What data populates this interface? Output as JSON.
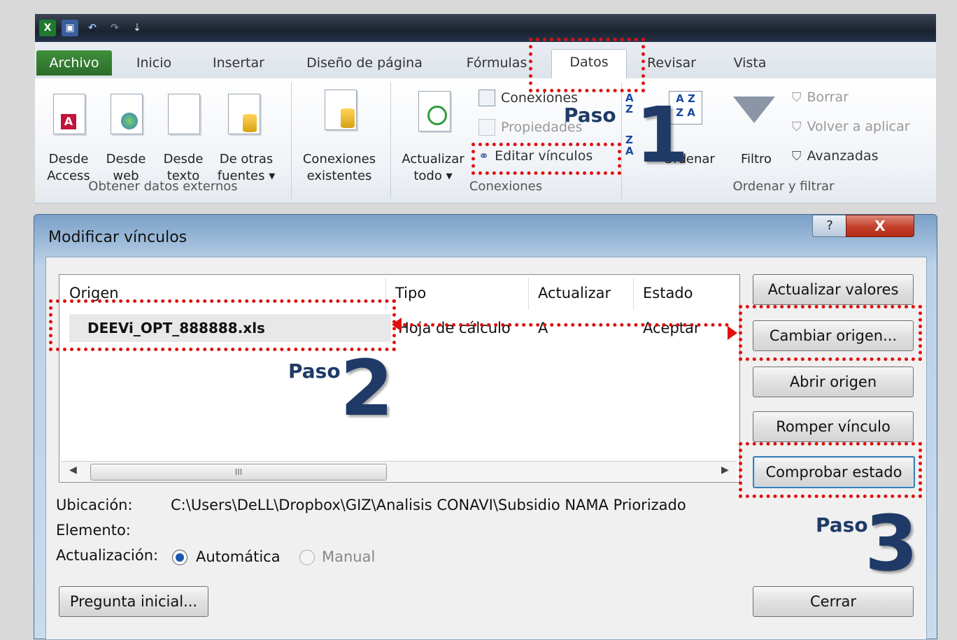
{
  "excel": {
    "tabs": [
      "Archivo",
      "Inicio",
      "Insertar",
      "Diseño de página",
      "Fórmulas",
      "Datos",
      "Revisar",
      "Vista"
    ],
    "obtener": {
      "buttons": [
        {
          "line1": "Desde",
          "line2": "Access"
        },
        {
          "line1": "Desde",
          "line2": "web"
        },
        {
          "line1": "Desde",
          "line2": "texto"
        },
        {
          "line1": "De otras",
          "line2": "fuentes ▾"
        }
      ],
      "group_label": "Obtener datos externos"
    },
    "conexiones_existentes": {
      "line1": "Conexiones",
      "line2": "existentes"
    },
    "conexiones_group": {
      "actualizar": {
        "line1": "Actualizar",
        "line2": "todo ▾"
      },
      "items": [
        "Conexiones",
        "Propiedades",
        "Editar vínculos"
      ],
      "group_label": "Conexiones"
    },
    "ordenar_group": {
      "ordenar": "Ordenar",
      "filtro": "Filtro",
      "items": [
        "Borrar",
        "Volver a aplicar",
        "Avanzadas"
      ],
      "group_label": "Ordenar y filtrar"
    }
  },
  "annotations": {
    "paso_label": "Paso",
    "step1": "1",
    "step2": "2",
    "step3": "3"
  },
  "dialog": {
    "title": "Modificar vínculos",
    "help": "?",
    "close": "X",
    "columns": [
      "Origen",
      "Tipo",
      "Actualizar",
      "Estado"
    ],
    "rows": [
      {
        "origen": "DEEVi_OPT_888888.xls",
        "tipo": "Hoja de cálculo",
        "actualizar": "A",
        "estado": "Aceptar"
      }
    ],
    "scroll_thumb": "III",
    "buttons": [
      "Actualizar valores",
      "Cambiar origen...",
      "Abrir origen",
      "Romper vínculo",
      "Comprobar estado"
    ],
    "ubicacion_label": "Ubicación:",
    "ubicacion_value": "C:\\Users\\DeLL\\Dropbox\\GIZ\\Analisis CONAVI\\Subsidio NAMA Priorizado",
    "elemento_label": "Elemento:",
    "actualizacion_label": "Actualización:",
    "auto_label": "Automática",
    "manual_label": "Manual",
    "pregunta": "Pregunta inicial...",
    "cerrar": "Cerrar"
  }
}
